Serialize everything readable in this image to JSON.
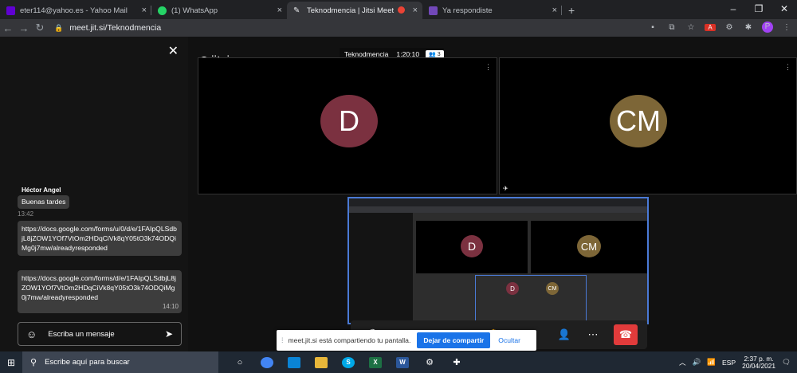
{
  "browser": {
    "tabs": [
      {
        "label": "eter114@yahoo.es - Yahoo Mail",
        "icon": "yahoo-mail-icon",
        "color": "#6001d2"
      },
      {
        "label": "(1) WhatsApp",
        "icon": "whatsapp-icon",
        "color": "#25d366"
      },
      {
        "label": "Teknodmencia | Jitsi Meet",
        "icon": "jitsi-icon",
        "color": "#e8eaed"
      },
      {
        "label": "Ya respondiste",
        "icon": "google-forms-icon",
        "color": "#7248b9"
      }
    ],
    "url": "meet.jit.si/Teknodmencia"
  },
  "chat": {
    "sender": "Héctor Angel",
    "messages": [
      {
        "text": "Buenas tardes",
        "time": "13:42"
      },
      {
        "text": "https://docs.google.com/forms/u/0/d/e/1FAIpQLSdbjL8jZOW1YOf7VtOm2HDqCiVk8qY05tO3k74ODQiMg0j7mw/alreadyresponded",
        "time": ""
      },
      {
        "text": "https://docs.google.com/forms/d/e/1FAIpQLSdbjL8jZOW1YOf7VtOm2HDqCiVk8qY05tO3k74ODQiMg0j7mw/alreadyresponded",
        "time": "14:10"
      }
    ],
    "input_placeholder": "Escriba un mensaje"
  },
  "meeting": {
    "logo": "jitsi",
    "title": "Teknodmencia",
    "timer": "1:20:10",
    "participants": "3",
    "tiles": [
      {
        "initials": "D",
        "color": "#7b3140"
      },
      {
        "initials": "CM",
        "color": "#7d6637"
      }
    ]
  },
  "share_notice": {
    "text": "meet.jit.si está compartiendo tu pantalla.",
    "stop_label": "Dejar de compartir",
    "hide_label": "Ocultar"
  },
  "taskbar": {
    "search_placeholder": "Escribe aquí para buscar",
    "language": "ESP",
    "time": "2:37 p. m.",
    "date": "20/04/2021"
  }
}
